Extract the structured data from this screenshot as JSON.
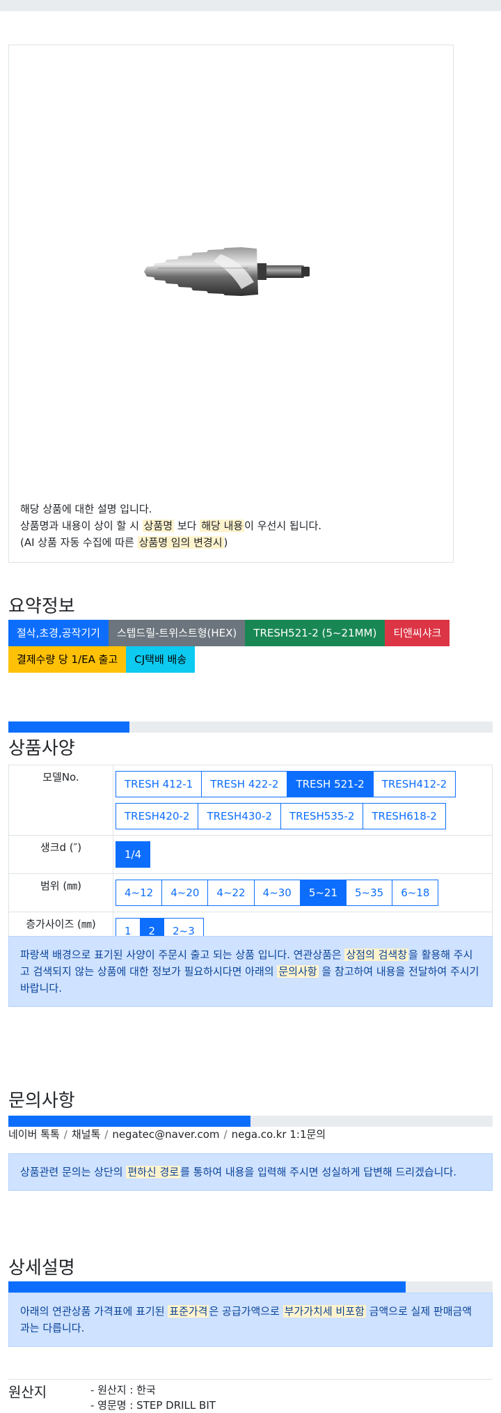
{
  "product_image": {
    "alt": "STEP DRILL BIT"
  },
  "notice": {
    "line1": "해당 상품에 대한 설명 입니다.",
    "line2_a": "상품명과 내용이 상이 할 시 ",
    "line2_hl1": "상품명",
    "line2_b": " 보다 ",
    "line2_hl2": "해당 내용",
    "line2_c": "이 우선시 됩니다.",
    "line3_a": "(AI 상품 자동 수집에 따른 ",
    "line3_hl": "상품명 임의 변경시",
    "line3_b": ")"
  },
  "summary": {
    "title": "요약정보",
    "chips": [
      "절삭,초경,공작기기",
      "스텝드릴-트위스트형(HEX)",
      "TRESH521-2 (5~21MM)",
      "티앤씨샤크",
      "결제수량 당 1/EA 출고",
      "CJ택배 배송"
    ]
  },
  "spec": {
    "title": "상품사양",
    "progress": 0.25,
    "rows": [
      {
        "label": "모델No.",
        "options": [
          "TRESH 412-1",
          "TRESH 422-2",
          "TRESH 521-2",
          "TRESH412-2",
          "TRESH420-2",
          "TRESH430-2",
          "TRESH535-2",
          "TRESH618-2"
        ],
        "selected": "TRESH 521-2"
      },
      {
        "label": "생크d (″)",
        "options": [
          "1/4"
        ],
        "selected": "1/4"
      },
      {
        "label": "범위 (㎜)",
        "options": [
          "4~12",
          "4~20",
          "4~22",
          "4~30",
          "5~21",
          "5~35",
          "6~18"
        ],
        "selected": "5~21"
      },
      {
        "label": "층가사이즈 (㎜)",
        "options": [
          "1",
          "2",
          "2~3"
        ],
        "selected": "2"
      }
    ],
    "info_a": "파랑색 배경으로 표기된 사양이 주문시 출고 되는 상품 입니다. 연관상품은 ",
    "info_hl1": "상점의 검색창",
    "info_b": "을 활용해 주시고 검색되지 않는 상품에 대한 정보가 필요하시다면 아래의 ",
    "info_hl2": "문의사항",
    "info_c": " 을 참고하여 내용을 전달하여 주시기 바랍니다."
  },
  "inquiry": {
    "title": "문의사항",
    "progress": 0.5,
    "contacts": [
      "네이버 톡톡",
      "채널톡",
      "negatec@naver.com",
      "nega.co.kr 1:1문의"
    ],
    "separator": "/",
    "info_a": "상품관련 문의는 상단의 ",
    "info_hl": "편하신 경로",
    "info_b": "를 통하여 내용을 입력해 주시면 성실하게 답변해 드리겠습니다."
  },
  "detail": {
    "title": "상세설명",
    "progress": 0.82,
    "info_a": "아래의 연관상품 가격표에 표기된 ",
    "info_hl1": "표준가격",
    "info_b": "은 공급가액으로 ",
    "info_hl2": "부가가치세 비포함",
    "info_c": " 금액으로 실제 판매금액과는 다릅니다."
  },
  "origin": {
    "label": "원산지",
    "line1": "- 원산지 : 한국",
    "line2": "- 영문명 : STEP DRILL BIT"
  },
  "colors": {
    "primary": "#0d6efd",
    "secondary": "#6c757d",
    "success": "#198754",
    "danger": "#dc3545",
    "warning": "#ffc107",
    "info": "#0dcaf0"
  }
}
